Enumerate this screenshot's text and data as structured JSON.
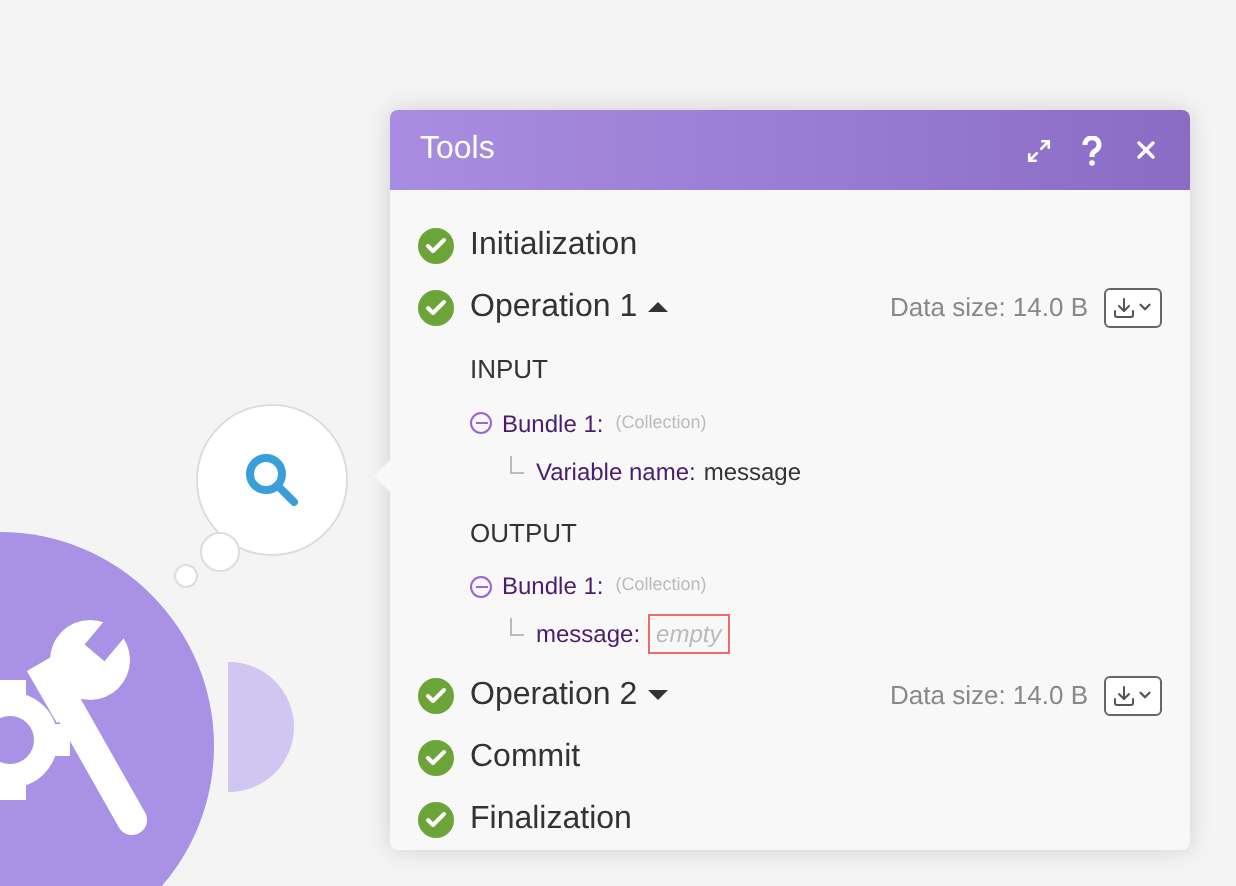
{
  "panel": {
    "title": "Tools"
  },
  "steps": [
    {
      "label": "Initialization",
      "kind": "plain"
    },
    {
      "label": "Operation 1",
      "kind": "operation",
      "expanded": true,
      "data_size": "Data size: 14.0 B",
      "sections": [
        {
          "heading": "INPUT",
          "bundles": [
            {
              "label": "Bundle 1:",
              "type": "(Collection)",
              "expanded": true,
              "fields": [
                {
                  "name": "Variable name:",
                  "value": "message",
                  "kind": "text",
                  "highlighted": false
                }
              ]
            }
          ]
        },
        {
          "heading": "OUTPUT",
          "bundles": [
            {
              "label": "Bundle 1:",
              "type": "(Collection)",
              "expanded": true,
              "fields": [
                {
                  "name": "message:",
                  "value": "empty",
                  "kind": "empty",
                  "highlighted": true
                }
              ]
            }
          ]
        }
      ]
    },
    {
      "label": "Operation 2",
      "kind": "operation",
      "expanded": false,
      "data_size": "Data size: 14.0 B"
    },
    {
      "label": "Commit",
      "kind": "plain"
    },
    {
      "label": "Finalization",
      "kind": "plain"
    }
  ]
}
